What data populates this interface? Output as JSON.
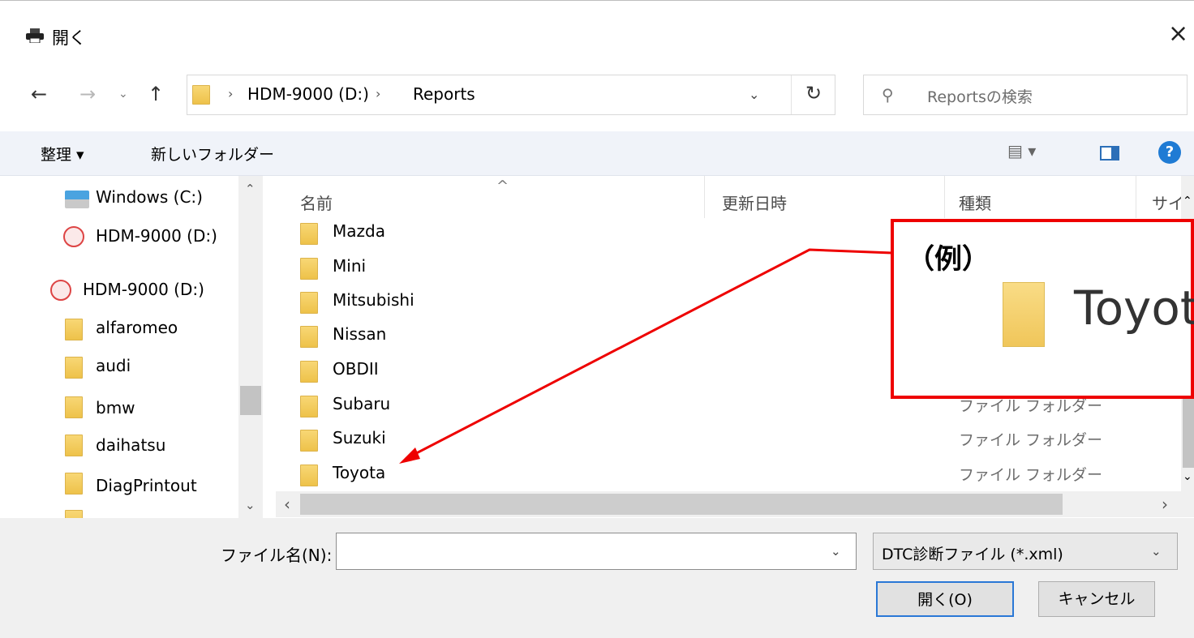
{
  "window": {
    "title": "開く",
    "close_glyph": "×"
  },
  "navigation": {
    "back": "←",
    "forward": "→",
    "recent": "⌄",
    "up": "↑",
    "path": [
      "HDM-9000 (D:)",
      "Reports"
    ],
    "separator": "›",
    "dropdown": "⌄",
    "refresh": "↻"
  },
  "search": {
    "placeholder": "Reportsの検索",
    "icon": "search-icon"
  },
  "toolbar": {
    "organize": "整理 ▾",
    "new_folder": "新しいフォルダー",
    "view": "▤ ▾",
    "help": "?"
  },
  "sidebar": {
    "items": [
      {
        "label": "Windows (C:)",
        "icon": "windows-drive-icon"
      },
      {
        "label": "HDM-9000 (D:)",
        "icon": "drive-icon"
      },
      {
        "label": "HDM-9000 (D:)",
        "icon": "drive-icon"
      },
      {
        "label": "alfaromeo",
        "icon": "folder-icon"
      },
      {
        "label": "audi",
        "icon": "folder-icon"
      },
      {
        "label": "bmw",
        "icon": "folder-icon"
      },
      {
        "label": "daihatsu",
        "icon": "folder-icon"
      },
      {
        "label": "DiagPrintout",
        "icon": "folder-icon"
      }
    ]
  },
  "columns": {
    "name": "名前",
    "modified": "更新日時",
    "type": "種類",
    "size": "サイ"
  },
  "files": [
    {
      "name": "Mazda",
      "type": ""
    },
    {
      "name": "Mini",
      "type": ""
    },
    {
      "name": "Mitsubishi",
      "type": ""
    },
    {
      "name": "Nissan",
      "type": ""
    },
    {
      "name": "OBDII",
      "type": ""
    },
    {
      "name": "Subaru",
      "type": "ファイル フォルダー"
    },
    {
      "name": "Suzuki",
      "type": "ファイル フォルダー"
    },
    {
      "name": "Toyota",
      "type": "ファイル フォルダー"
    }
  ],
  "footer": {
    "filename_label": "ファイル名(N):",
    "filename_value": "",
    "filetype": "DTC診断ファイル (*.xml)",
    "open": "開く(O)",
    "cancel": "キャンセル"
  },
  "annotation": {
    "label": "（例）",
    "example": "Toyot",
    "color": "#ee0000"
  },
  "colors": {
    "accent": "#2a78d6",
    "folder": "#f0c65a"
  }
}
